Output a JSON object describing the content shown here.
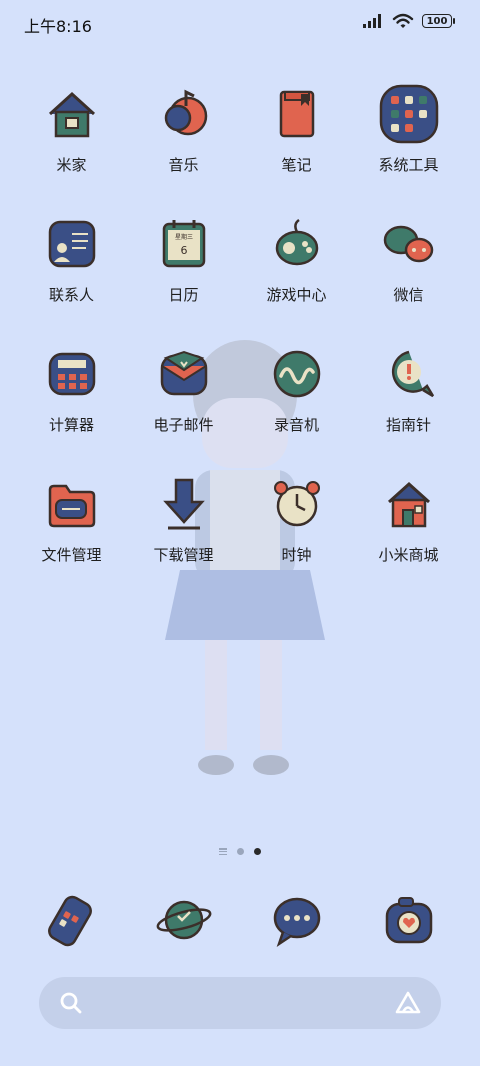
{
  "status": {
    "time": "上午8:16",
    "battery": "100",
    "icons": [
      "signal-icon",
      "wifi-icon",
      "battery-icon"
    ]
  },
  "apps": [
    {
      "name": "米家",
      "icon": "mijia-house-icon"
    },
    {
      "name": "音乐",
      "icon": "music-icon"
    },
    {
      "name": "笔记",
      "icon": "notes-icon"
    },
    {
      "name": "系统工具",
      "icon": "system-tools-folder-icon"
    },
    {
      "name": "联系人",
      "icon": "contacts-icon"
    },
    {
      "name": "日历",
      "icon": "calendar-icon",
      "calendar_weekday": "星期三",
      "calendar_day": "6"
    },
    {
      "name": "游戏中心",
      "icon": "game-controller-icon"
    },
    {
      "name": "微信",
      "icon": "wechat-icon"
    },
    {
      "name": "计算器",
      "icon": "calculator-icon"
    },
    {
      "name": "电子邮件",
      "icon": "email-icon"
    },
    {
      "name": "录音机",
      "icon": "recorder-icon"
    },
    {
      "name": "指南针",
      "icon": "compass-icon"
    },
    {
      "name": "文件管理",
      "icon": "file-manager-icon"
    },
    {
      "name": "下载管理",
      "icon": "download-icon"
    },
    {
      "name": "时钟",
      "icon": "alarm-clock-icon"
    },
    {
      "name": "小米商城",
      "icon": "mi-store-icon"
    }
  ],
  "dock": [
    {
      "icon": "phone-icon"
    },
    {
      "icon": "browser-icon"
    },
    {
      "icon": "messages-icon"
    },
    {
      "icon": "camera-icon"
    }
  ],
  "pages": {
    "count": 2,
    "current": 2
  },
  "colors": {
    "background": "#d5e1fb",
    "navy": "#3a4f86",
    "green": "#3f7a6a",
    "coral": "#e0644f",
    "outline": "#3b2f2a"
  }
}
